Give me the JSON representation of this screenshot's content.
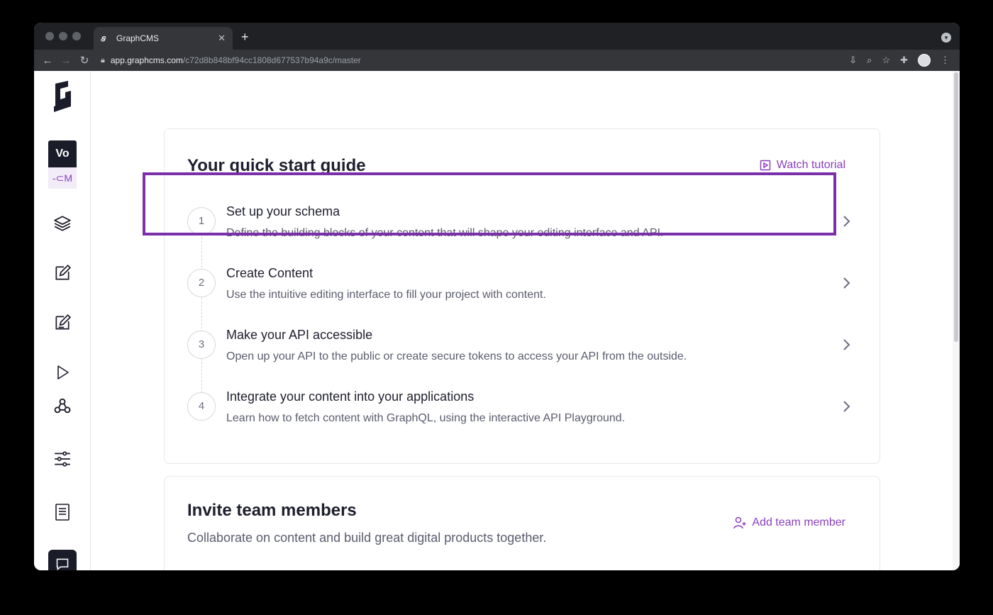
{
  "browser": {
    "tab_title": "GraphCMS",
    "tab_close": "✕",
    "new_tab": "+",
    "url_host": "app.graphcms.com",
    "url_path": "/c72d8b848bf94cc1808d677537b94a9c/master"
  },
  "sidebar": {
    "project_initials": "Vo",
    "environment_label": "-⊂M",
    "icons": [
      "layers-icon",
      "edit-icon",
      "edit-alt-icon",
      "play-icon",
      "webhooks-icon",
      "settings-sliders-icon",
      "docs-book-icon",
      "chat-icon"
    ]
  },
  "quickstart": {
    "title": "Your quick start guide",
    "action_label": "Watch tutorial",
    "steps": [
      {
        "num": "1",
        "title": "Set up your schema",
        "desc": "Define the building blocks of your content that will shape your editing interface and API."
      },
      {
        "num": "2",
        "title": "Create Content",
        "desc": "Use the intuitive editing interface to fill your project with content."
      },
      {
        "num": "3",
        "title": "Make your API accessible",
        "desc": "Open up your API to the public or create secure tokens to access your API from the outside."
      },
      {
        "num": "4",
        "title": "Integrate your content into your applications",
        "desc": "Learn how to fetch content with GraphQL, using the interactive API Playground."
      }
    ]
  },
  "team": {
    "title": "Invite team members",
    "subtitle": "Collaborate on content and build great digital products together.",
    "action_label": "Add team member"
  },
  "colors": {
    "accent": "#8a3ebf",
    "highlight": "#7b2fa8",
    "text_dark": "#1e1f2e"
  }
}
